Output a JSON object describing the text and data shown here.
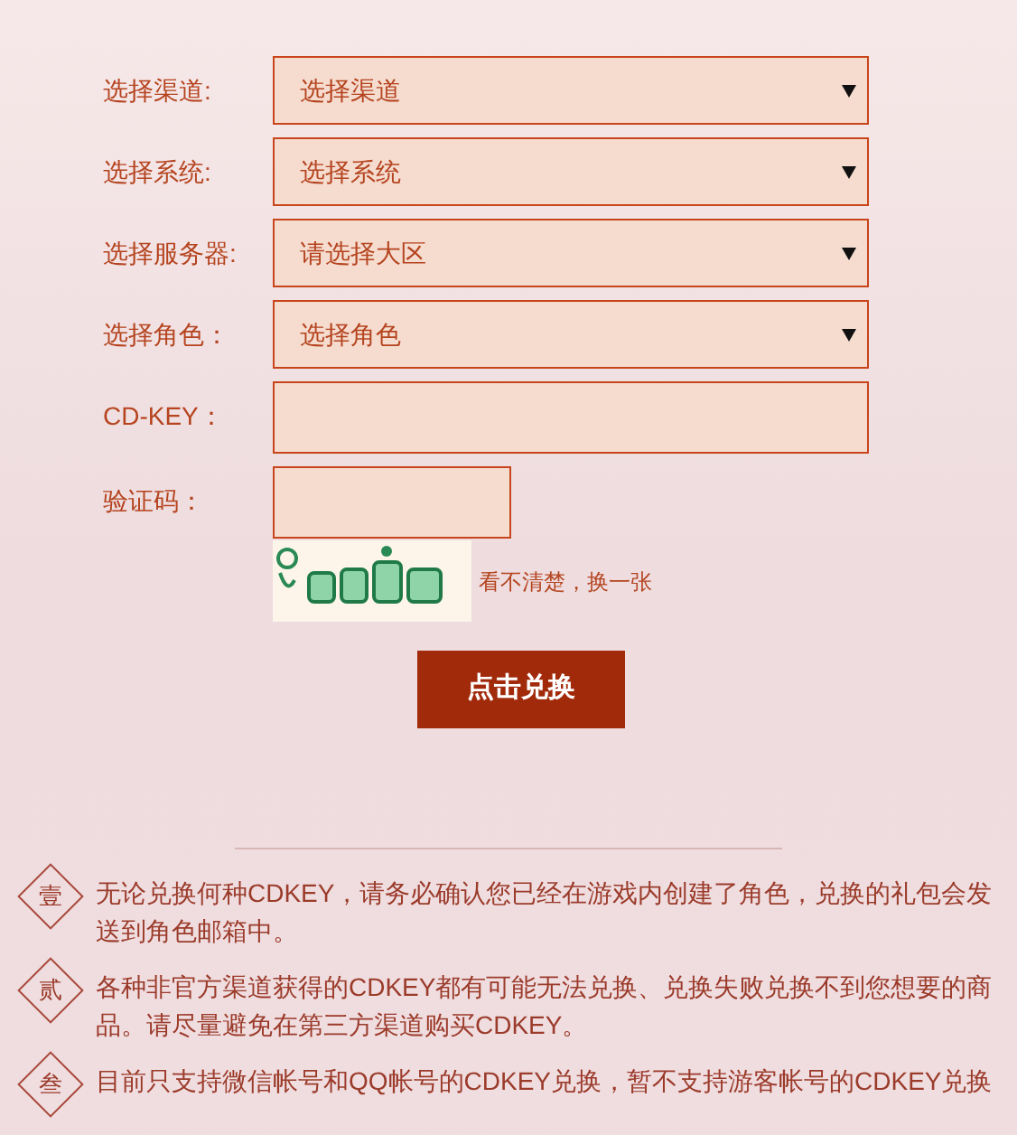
{
  "form": {
    "fields": [
      {
        "kind": "select",
        "label": "选择渠道:",
        "value": "选择渠道"
      },
      {
        "kind": "select",
        "label": "选择系统:",
        "value": "选择系统"
      },
      {
        "kind": "select",
        "label": "选择服务器:",
        "value": "请选择大区"
      },
      {
        "kind": "select",
        "label": "选择角色：",
        "value": "选择角色"
      },
      {
        "kind": "text",
        "label": "CD-KEY："
      },
      {
        "kind": "captcha",
        "label": "验证码："
      }
    ],
    "captcha": {
      "kind": "picture",
      "refresh_link": "看不清楚，换一张"
    },
    "submit": "点击兑换"
  },
  "notes": [
    {
      "marker": "壹",
      "text": "无论兑换何种CDKEY，请务必确认您已经在游戏内创建了角色，兑换的礼包会发送到角色邮箱中。"
    },
    {
      "marker": "贰",
      "text": "各种非官方渠道获得的CDKEY都有可能无法兑换、兑换失败兑换不到您想要的商品。请尽量避免在第三方渠道购买CDKEY。"
    },
    {
      "marker": "叁",
      "text": "目前只支持微信帐号和QQ帐号的CDKEY兑换，暂不支持游客帐号的CDKEY兑换"
    }
  ]
}
